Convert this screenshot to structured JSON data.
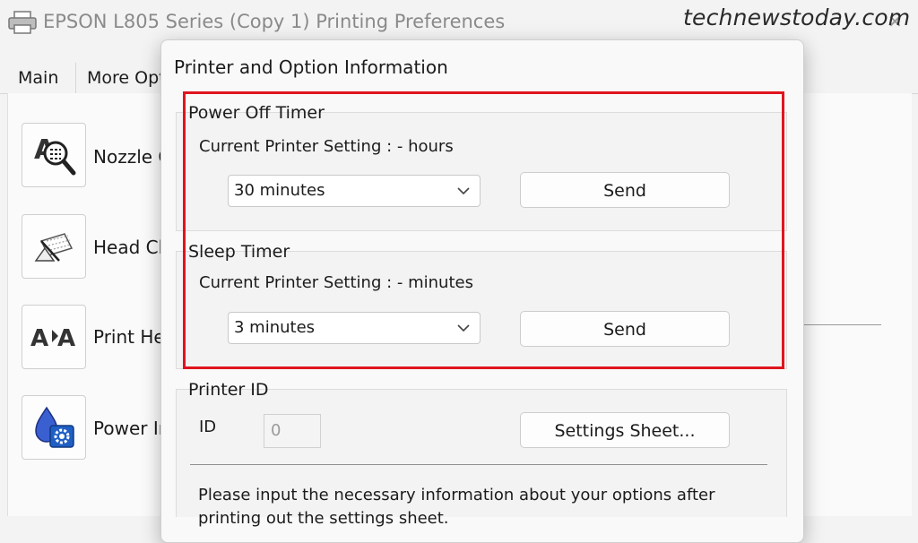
{
  "background_window": {
    "title": "EPSON L805 Series (Copy 1) Printing Preferences",
    "tabs": [
      {
        "label": "Main"
      },
      {
        "label": "More Opti"
      }
    ],
    "utilities": [
      {
        "label": "Nozzle C",
        "icon": "nozzle-check-icon"
      },
      {
        "label": "Head Cle",
        "icon": "head-cleaning-icon"
      },
      {
        "label": "Print Hea",
        "icon": "print-head-alignment-icon"
      },
      {
        "label": "Power In",
        "icon": "power-ink-flushing-icon"
      }
    ]
  },
  "watermark": "technewstoday.com",
  "dialog": {
    "title": "Printer and Option Information",
    "power_off_timer": {
      "group_title": "Power Off Timer",
      "current_setting": "Current Printer Setting : - hours",
      "selected": "30 minutes",
      "send_label": "Send"
    },
    "sleep_timer": {
      "group_title": "Sleep Timer",
      "current_setting": "Current Printer Setting : - minutes",
      "selected": "3 minutes",
      "send_label": "Send"
    },
    "printer_id": {
      "group_title": "Printer ID",
      "id_label": "ID",
      "id_value": "0",
      "settings_sheet_label": "Settings Sheet..."
    },
    "info_text": "Please input the necessary information about your options after printing out the settings sheet."
  },
  "colors": {
    "highlight": "#e0141e",
    "accent_blue": "#1f5fc4"
  }
}
